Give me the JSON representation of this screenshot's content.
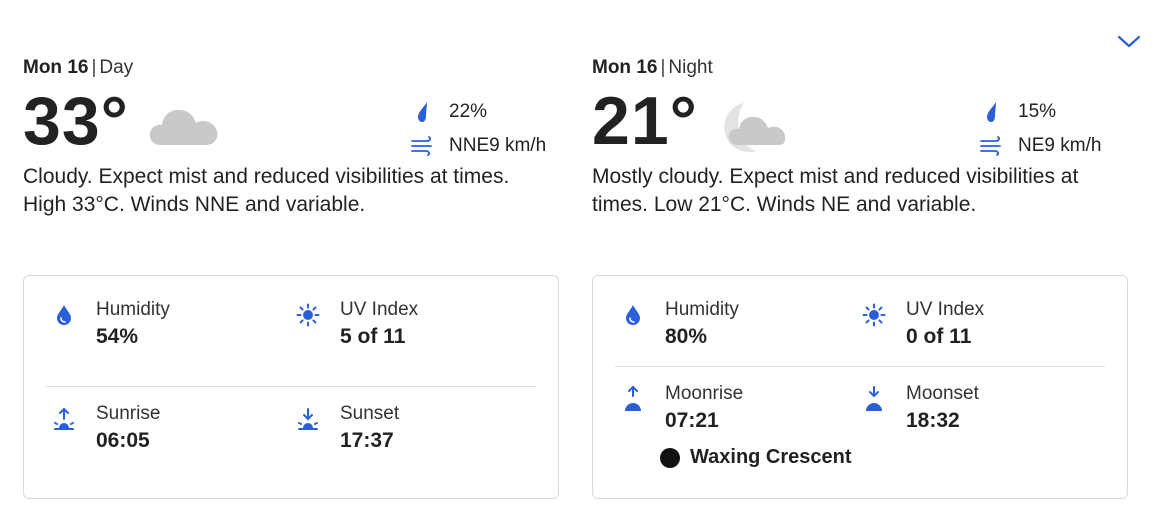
{
  "colors": {
    "accent": "#2b5fd9",
    "cloud": "#c9c9c9",
    "divider": "#dcdcdc"
  },
  "day": {
    "date": "Mon 16",
    "period": "Day",
    "temperature": "33°",
    "condition_icon": "cloud-icon",
    "precipitation": "22%",
    "wind": "NNE9 km/h",
    "description": "Cloudy. Expect mist and reduced visibilities at times. High 33°C. Winds NNE and variable.",
    "details": {
      "humidity_label": "Humidity",
      "humidity_value": "54%",
      "uv_label": "UV Index",
      "uv_value": "5 of 11",
      "sunrise_label": "Sunrise",
      "sunrise_value": "06:05",
      "sunset_label": "Sunset",
      "sunset_value": "17:37"
    }
  },
  "night": {
    "date": "Mon 16",
    "period": "Night",
    "temperature": "21°",
    "condition_icon": "moon-cloud-icon",
    "precipitation": "15%",
    "wind": "NE9 km/h",
    "description": "Mostly cloudy. Expect mist and reduced visibilities at times. Low 21°C. Winds NE and variable.",
    "details": {
      "humidity_label": "Humidity",
      "humidity_value": "80%",
      "uv_label": "UV Index",
      "uv_value": "0 of 11",
      "moonrise_label": "Moonrise",
      "moonrise_value": "07:21",
      "moonset_label": "Moonset",
      "moonset_value": "18:32",
      "moon_phase": "Waxing Crescent"
    }
  }
}
